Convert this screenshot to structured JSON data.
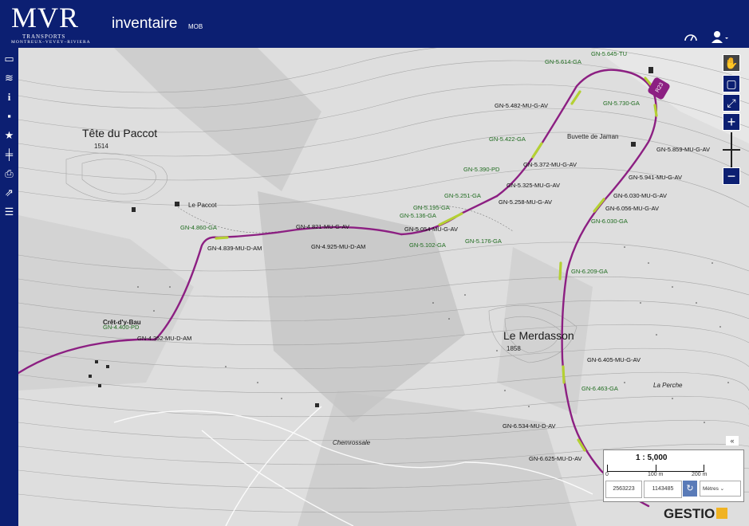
{
  "header": {
    "logo_mark": "MVR",
    "logo_line1": "TRANSPORTS",
    "logo_line2": "MONTREUX–VEVEY–RIVIERA",
    "app_title": "inventaire",
    "app_subtitle": "MOB"
  },
  "toolbar": [
    "folder-icon",
    "layers-icon",
    "info-icon",
    "comment-icon",
    "star-icon",
    "track-icon",
    "print-icon",
    "share-icon",
    "list-icon"
  ],
  "right_tools": [
    "hand-icon",
    "select-box-icon",
    "fullscreen-icon",
    "zoom-in-icon",
    "zoom-out-icon"
  ],
  "map": {
    "places": [
      {
        "name": "Tête du Paccot",
        "elev": "1514"
      },
      {
        "name": "Le Paccot"
      },
      {
        "name": "Crêt-d'y-Bau"
      },
      {
        "name": "Le Merdasson",
        "elev": "1858"
      },
      {
        "name": "Buvette de Jaman"
      },
      {
        "name": "La Perche"
      },
      {
        "name": "Chemrossale"
      }
    ],
    "track_labels_green": [
      "GN-5.614-GA",
      "GN-5.645-TU",
      "GN-5.730-GA",
      "GN-5.422-GA",
      "GN-5.390-PD",
      "GN-5.251-GA",
      "GN-5.195-GA",
      "GN-5.136-GA",
      "GN-5.102-GA",
      "GN-5.176-GA",
      "GN-4.860-GA",
      "GN-4.400-PD",
      "GN-6.030-GA",
      "GN-6.209-GA",
      "GN-6.463-GA"
    ],
    "track_labels_black": [
      "GN-5.482-MU-G-AV",
      "GN-5.372-MU-G-AV",
      "GN-5.325-MU-G-AV",
      "GN-5.258-MU-G-AV",
      "GN-5.054-MU-G-AV",
      "GN-4.821-MU-G-AV",
      "GN-4.839-MU-D-AM",
      "GN-4.925-MU-D-AM",
      "GN-4.352-MU-D-AM",
      "GN-5.859-MU-G-AV",
      "GN-5.941-MU-G-AV",
      "GN-6.030-MU-G-AV",
      "GN-6.056-MU-G-AV",
      "GN-6.405-MU-G-AV",
      "GN-6.534-MU-D-AV",
      "GN-6.625-MU-D-AV"
    ],
    "route_badge": "R23"
  },
  "scale": {
    "ratio": "1 : 5,000",
    "tick_0": "0",
    "tick_100": "100 m",
    "tick_200": "200 m",
    "coord_x": "2563223",
    "coord_y": "1143485",
    "unit": "Mètres",
    "collapse": "«"
  },
  "brand": {
    "name": "GESTIO"
  }
}
